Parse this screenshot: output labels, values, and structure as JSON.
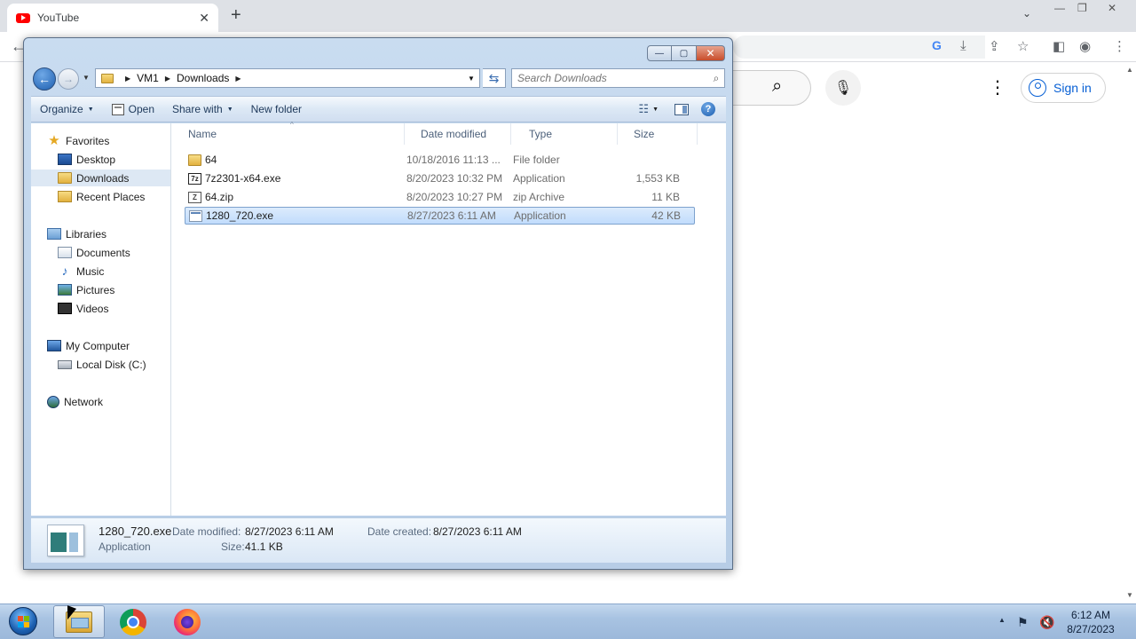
{
  "browser": {
    "tab_title": "YouTube",
    "tab_close": "✕",
    "new_tab": "+",
    "tab_search": "⌄",
    "window_controls": [
      "—",
      "❐",
      "✕"
    ],
    "back": "←",
    "toolbar_icons": [
      "download-icon",
      "share-icon",
      "bookmark-star-icon",
      "side-panel-icon",
      "profile-icon",
      "menu-icon"
    ]
  },
  "youtube": {
    "search_icon": "⌕",
    "mic_icon": "🎙",
    "more_icon": "⋮",
    "signin_label": "Sign in"
  },
  "explorer": {
    "title_buttons": [
      "—",
      "▢",
      "✕"
    ],
    "breadcrumb": [
      "VM1",
      "Downloads"
    ],
    "search_placeholder": "Search Downloads",
    "commands": {
      "organize": "Organize",
      "open": "Open",
      "share_with": "Share with",
      "new_folder": "New folder"
    },
    "nav": {
      "favorites": "Favorites",
      "desktop": "Desktop",
      "downloads": "Downloads",
      "recent_places": "Recent Places",
      "libraries": "Libraries",
      "documents": "Documents",
      "music": "Music",
      "pictures": "Pictures",
      "videos": "Videos",
      "my_computer": "My Computer",
      "local_disk": "Local Disk (C:)",
      "network": "Network"
    },
    "columns": {
      "name": "Name",
      "date": "Date modified",
      "type": "Type",
      "size": "Size"
    },
    "files": [
      {
        "name": "64",
        "date": "10/18/2016 11:13 ...",
        "type": "File folder",
        "size": "",
        "icon": "folder-icon"
      },
      {
        "name": "7z2301-x64.exe",
        "date": "8/20/2023 10:32 PM",
        "type": "Application",
        "size": "1,553 KB",
        "icon": "7zip-icon"
      },
      {
        "name": "64.zip",
        "date": "8/20/2023 10:27 PM",
        "type": "zip Archive",
        "size": "11 KB",
        "icon": "zip-icon"
      },
      {
        "name": "1280_720.exe",
        "date": "8/27/2023 6:11 AM",
        "type": "Application",
        "size": "42 KB",
        "icon": "exe-icon",
        "selected": true
      }
    ],
    "details": {
      "name": "1280_720.exe",
      "type": "Application",
      "modified_label": "Date modified:",
      "modified_value": "8/27/2023 6:11 AM",
      "created_label": "Date created:",
      "created_value": "8/27/2023 6:11 AM",
      "size_label": "Size:",
      "size_value": "41.1 KB"
    }
  },
  "taskbar": {
    "clock_time": "6:12 AM",
    "clock_date": "8/27/2023",
    "tray_up": "▲"
  }
}
